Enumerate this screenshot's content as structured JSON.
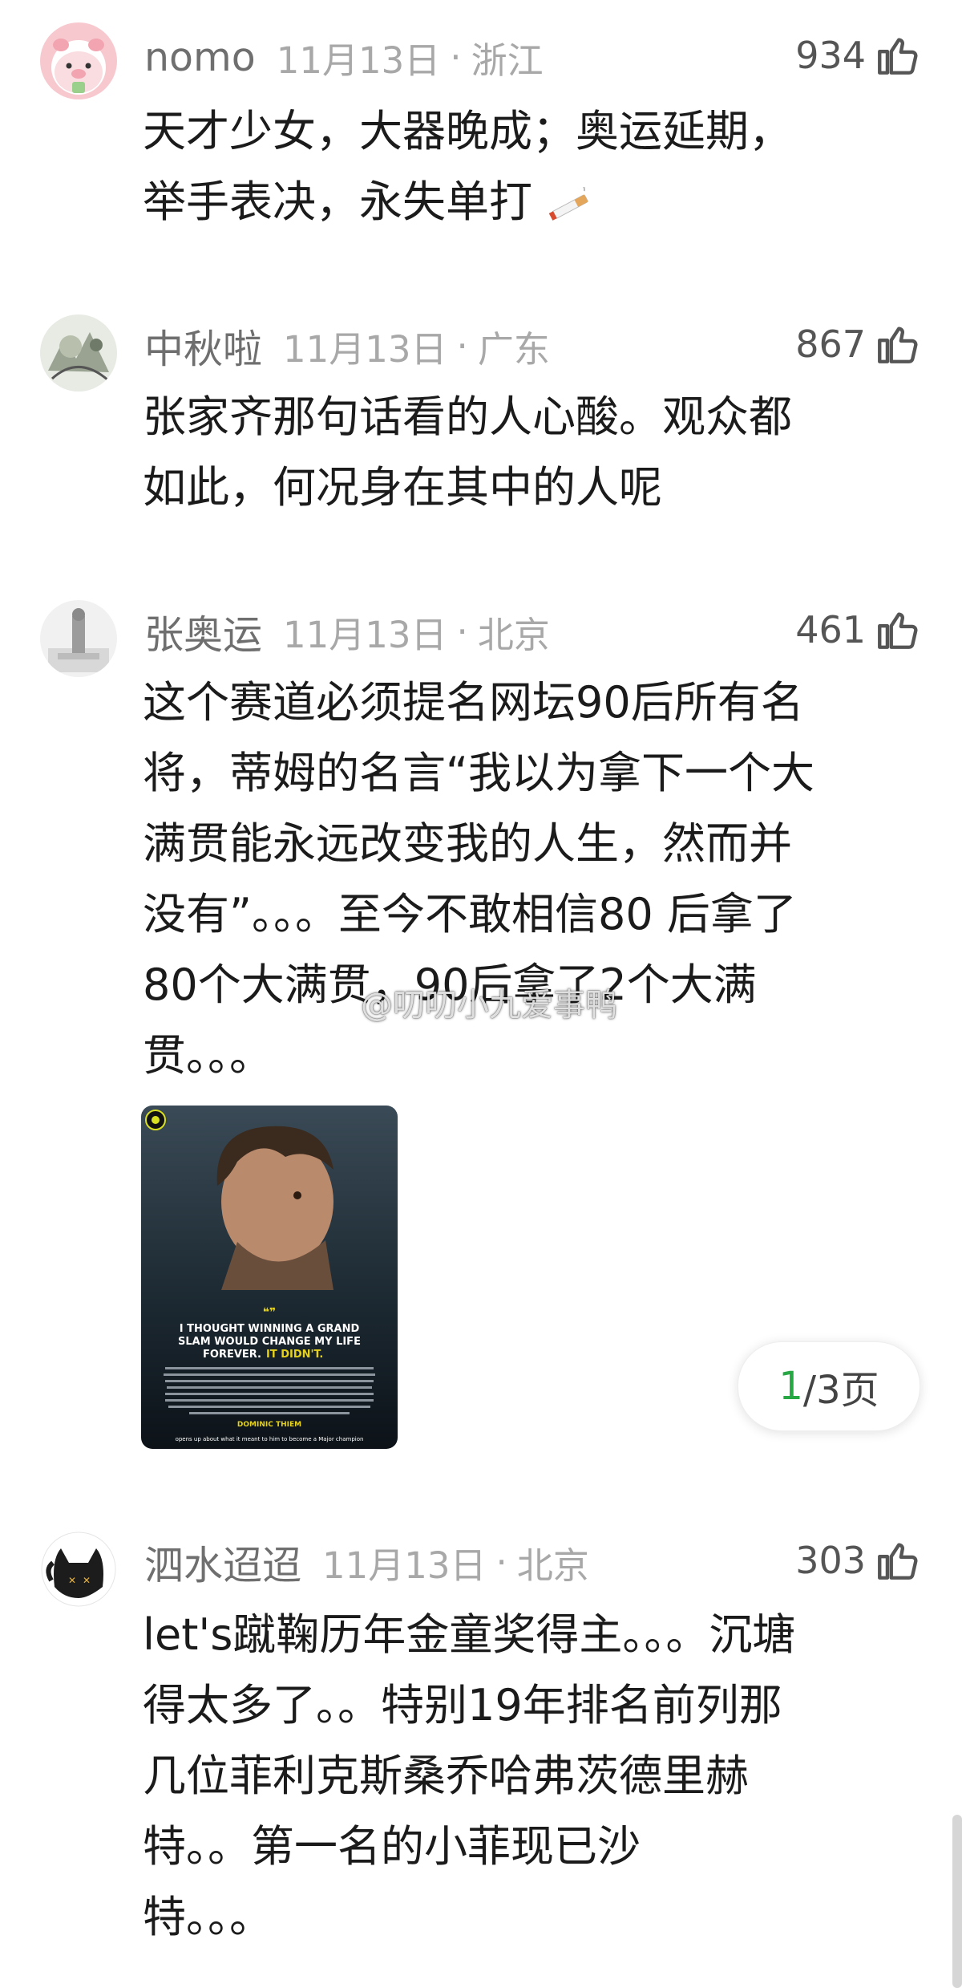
{
  "comments": [
    {
      "user": "nomo",
      "time": "11月13日",
      "sep": "·",
      "location": "浙江",
      "likes": "934",
      "lines": [
        "天才少女，大器晚成；奥运延期，",
        "举手表决，永失单打"
      ],
      "emoji": "cigarette-emoji"
    },
    {
      "user": "中秋啦",
      "time": "11月13日",
      "sep": "·",
      "location": "广东",
      "likes": "867",
      "lines": [
        "张家齐那句话看的人心酸。观众都",
        "如此，何况身在其中的人呢"
      ]
    },
    {
      "user": "张奥运",
      "time": "11月13日",
      "sep": "·",
      "location": "北京",
      "likes": "461",
      "lines": [
        "这个赛道必须提名网坛90后所有名",
        "将，蒂姆的名言“我以为拿下一个大",
        "满贯能永远改变我的人生，然而并",
        "没有”。。。至今不敢相信80 后拿了",
        "80个大满贯，90后拿了2个大满",
        "贯。。。"
      ],
      "image": {
        "quote_mark": "❝❞",
        "headline_a": "I THOUGHT WINNING A GRAND",
        "headline_b": "SLAM WOULD CHANGE MY LIFE",
        "headline_c": "FOREVER.",
        "headline_accent": "IT DIDN'T.",
        "name": "DOMINIC THIEM",
        "caption": "opens up about what it meant to him to become a Major champion"
      },
      "pager": {
        "current": "1",
        "rest": "/3页"
      }
    },
    {
      "user": "泗水迢迢",
      "time": "11月13日",
      "sep": "·",
      "location": "北京",
      "likes": "303",
      "lines": [
        "let's蹴鞠历年金童奖得主。。。沉塘",
        "得太多了。。特别19年排名前列那",
        "几位菲利克斯桑乔哈弗茨德里赫",
        "特。。第一名的小菲现已沙",
        "特。。。"
      ]
    }
  ],
  "watermark": "@叨叨小九爱事鸭",
  "colors": {
    "accent_green": "#28a745",
    "name_gray": "#6f6f6f",
    "meta_gray": "#a8a8a8"
  }
}
